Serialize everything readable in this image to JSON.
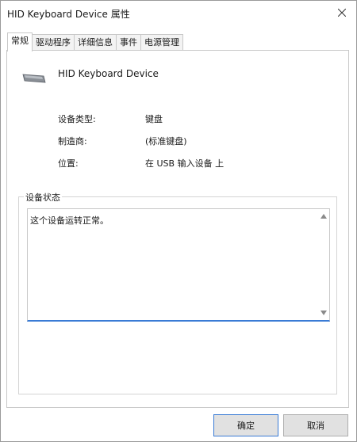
{
  "window": {
    "title": "HID Keyboard Device 属性"
  },
  "tabs": [
    {
      "label": "常规",
      "active": true
    },
    {
      "label": "驱动程序",
      "active": false
    },
    {
      "label": "详细信息",
      "active": false
    },
    {
      "label": "事件",
      "active": false
    },
    {
      "label": "电源管理",
      "active": false
    }
  ],
  "device": {
    "name": "HID Keyboard Device",
    "icon": "keyboard-icon"
  },
  "properties": {
    "type_label": "设备类型:",
    "type_value": "键盘",
    "manufacturer_label": "制造商:",
    "manufacturer_value": "(标准键盘)",
    "location_label": "位置:",
    "location_value": "在 USB 输入设备 上"
  },
  "status": {
    "group_title": "设备状态",
    "text": "这个设备运转正常。"
  },
  "buttons": {
    "ok": "确定",
    "cancel": "取消"
  }
}
